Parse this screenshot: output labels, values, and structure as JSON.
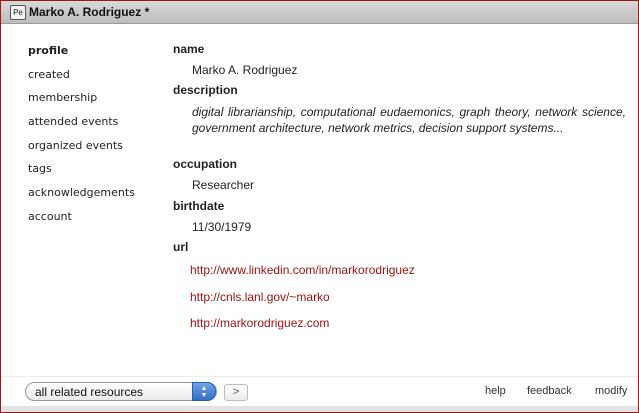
{
  "window": {
    "type_icon_label": "Pe",
    "title": "Marko A. Rodriguez *"
  },
  "sidebar": {
    "items": [
      {
        "label": "profile",
        "active": true
      },
      {
        "label": "created"
      },
      {
        "label": "membership"
      },
      {
        "label": "attended events"
      },
      {
        "label": "organized events"
      },
      {
        "label": "tags"
      },
      {
        "label": "acknowledgements"
      },
      {
        "label": "account"
      }
    ]
  },
  "profile": {
    "name_label": "name",
    "name": "Marko A. Rodriguez",
    "description_label": "description",
    "description": "digital librarianship, computational eudaemonics, graph theory, network science, government architecture, network metrics, decision support systems...",
    "occupation_label": "occupation",
    "occupation": "Researcher",
    "birthdate_label": "birthdate",
    "birthdate": "11/30/1979",
    "url_label": "url",
    "urls": [
      "http://www.linkedin.com/in/markorodriguez",
      "http://cnls.lanl.gov/~marko",
      "http://markorodriguez.com"
    ]
  },
  "footer": {
    "select_value": "all related resources",
    "next_label": ">",
    "help_label": "help",
    "feedback_label": "feedback",
    "modify_label": "modify"
  },
  "colors": {
    "window_border": "#8f1d1a",
    "link": "#9b1010",
    "select_stepper": "#2f6fc8"
  }
}
